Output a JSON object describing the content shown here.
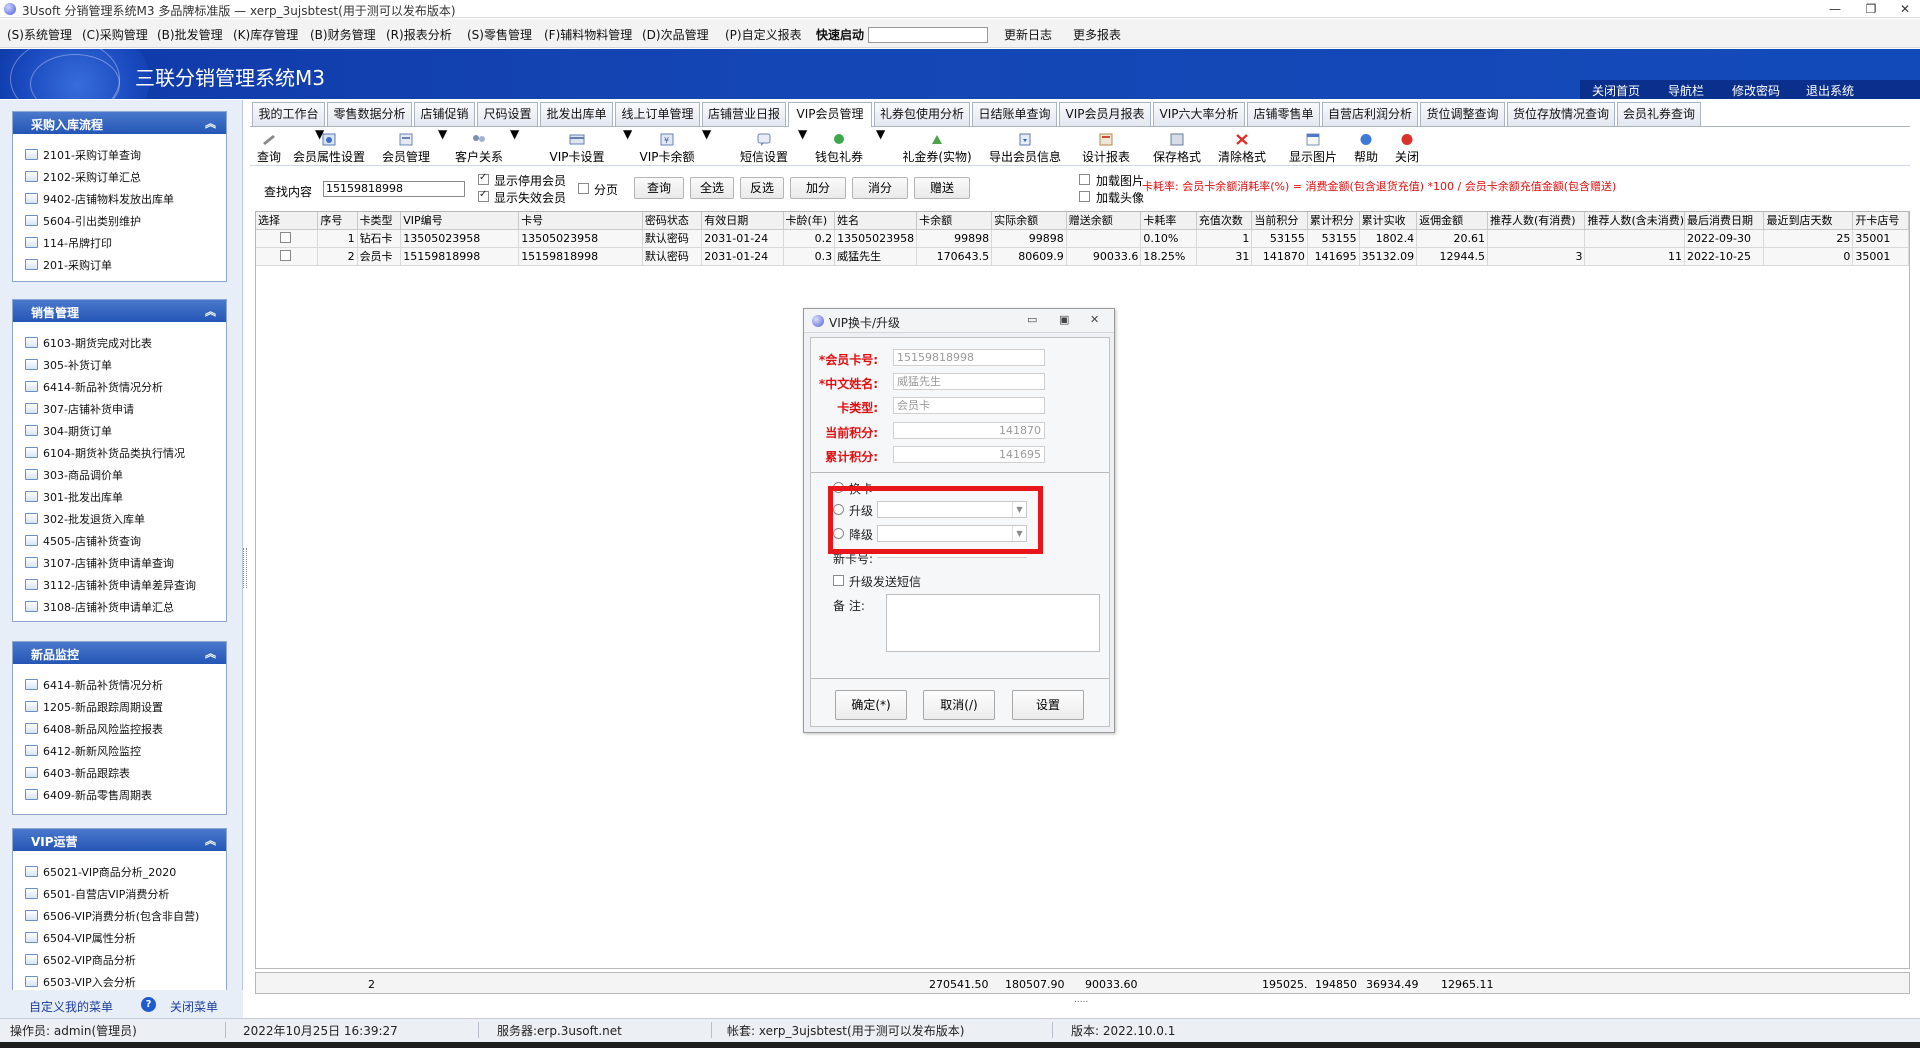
{
  "window": {
    "title": "3Usoft 分销管理系统M3 多品牌标准版 — xerp_3ujsbtest(用于测可以发布版本)",
    "controls": {
      "minimize": "—",
      "restore": "❐",
      "close": "✕"
    }
  },
  "menu": {
    "items": [
      "(S)系统管理",
      "(C)采购管理",
      "(B)批发管理",
      "(K)库存管理",
      "(B)财务管理",
      "(R)报表分析",
      "(S)零售管理",
      "(F)辅料物料管理",
      "(D)次品管理",
      "(P)自定义报表"
    ],
    "quick_launch_label": "快速启动",
    "quick_launch_value": "",
    "update_log": "更新日志",
    "more_reports": "更多报表"
  },
  "banner": {
    "title": "三联分销管理系统M3",
    "links": [
      "关闭首页",
      "导航栏",
      "修改密码",
      "退出系统"
    ]
  },
  "sidebar": {
    "panels": [
      {
        "title": "采购入库流程",
        "items": [
          "2101-采购订单查询",
          "2102-采购订单汇总",
          "9402-店铺物料发放出库单",
          "5604-引出类别维护",
          "114-吊牌打印",
          "201-采购订单"
        ]
      },
      {
        "title": "销售管理",
        "items": [
          "6103-期货完成对比表",
          "305-补货订单",
          "6414-新品补货情况分析",
          "307-店铺补货申请",
          "304-期货订单",
          "6104-期货补货品类执行情况",
          "303-商品调价单",
          "301-批发出库单",
          "302-批发退货入库单",
          "4505-店铺补货查询",
          "3107-店铺补货申请单查询",
          "3112-店铺补货申请单差异查询",
          "3108-店铺补货申请单汇总"
        ]
      },
      {
        "title": "新品监控",
        "items": [
          "6414-新品补货情况分析",
          "1205-新品跟踪周期设置",
          "6408-新品风险监控报表",
          "6412-新新风险监控",
          "6403-新品跟踪表",
          "6409-新品零售周期表"
        ]
      },
      {
        "title": "VIP运营",
        "items": [
          "65021-VIP商品分析_2020",
          "6501-自营店VIP消费分析",
          "6506-VIP消费分析(包含非自营)",
          "6504-VIP属性分析",
          "6502-VIP商品分析",
          "6503-VIP入会分析"
        ]
      }
    ],
    "chevron": "︽",
    "bottom": {
      "custom_menu": "自定义我的菜单",
      "help": "?",
      "close_menu": "关闭菜单"
    }
  },
  "tabs": [
    "我的工作台",
    "零售数据分析",
    "店铺促销",
    "尺码设置",
    "批发出库单",
    "线上订单管理",
    "店铺营业日报",
    "VIP会员管理",
    "礼券包使用分析",
    "日结账单查询",
    "VIP会员月报表",
    "VIP六大率分析",
    "店铺零售单",
    "自营店利润分析",
    "货位调整查询",
    "货位存放情况查询",
    "会员礼券查询"
  ],
  "active_tab": 7,
  "toolbar": {
    "items": [
      "查询",
      "会员属性设置",
      "会员管理",
      "客户关系",
      "VIP卡设置",
      "VIP卡余额",
      "短信设置",
      "钱包礼券",
      "礼金券(实物)",
      "导出会员信息",
      "设计报表",
      "保存格式",
      "清除格式",
      "显示图片",
      "帮助",
      "关闭"
    ],
    "dropdown_arrow": "▼"
  },
  "search": {
    "label": "查找内容",
    "value": "15159818998",
    "opts": [
      "显示停用会员",
      "显示失效会员",
      "分页",
      "加载图片",
      "加载头像"
    ],
    "buttons": [
      "查询",
      "全选",
      "反选",
      "加分",
      "消分",
      "赠送"
    ],
    "formula": "卡耗率: 会员卡余额消耗率(%) = 消费金额(包含退货充值) *100 / 会员卡余额充值金额(包含赠送)"
  },
  "grid": {
    "columns": [
      "选择",
      "序号",
      "卡类型",
      "VIP编号",
      "卡号",
      "密码状态",
      "有效日期",
      "卡龄(年)",
      "姓名",
      "卡余额",
      "实际余额",
      "赠送余额",
      "卡耗率",
      "充值次数",
      "当前积分",
      "累计积分",
      "累计实收",
      "返佣金额",
      "推荐人数(有消费)",
      "推荐人数(含未消费)",
      "最后消费日期",
      "最近到店天数",
      "开卡店号"
    ],
    "rows": [
      [
        "",
        "1",
        "钻石卡",
        "13505023958",
        "13505023958",
        "默认密码",
        "2031-01-24",
        "0.2",
        "13505023958",
        "99898",
        "99898",
        "",
        "0.10%",
        "1",
        "53155",
        "53155",
        "1802.4",
        "20.61",
        "",
        "",
        "2022-09-30",
        "25",
        "35001"
      ],
      [
        "",
        "2",
        "会员卡",
        "15159818998",
        "15159818998",
        "默认密码",
        "2031-01-24",
        "0.3",
        "威猛先生",
        "170643.5",
        "80609.9",
        "90033.6",
        "18.25%",
        "31",
        "141870",
        "141695",
        "35132.09",
        "12944.5",
        "3",
        "11",
        "2022-10-25",
        "0",
        "35001"
      ]
    ],
    "footer": {
      "count": "2",
      "card_balance": "270541.50",
      "actual_balance": "180507.90",
      "gift_balance": "90033.60",
      "current_points": "195025.",
      "total_points": "194850",
      "total_received": "36934.49",
      "rebate": "12965.11"
    },
    "resize_grip": "....."
  },
  "dialog": {
    "title": "VIP换卡/升级",
    "controls": {
      "min": "▭",
      "max": "▣",
      "close": "✕"
    },
    "card_no_label": "*会员卡号:",
    "card_no": "15159818998",
    "name_label": "*中文姓名:",
    "name": "威猛先生",
    "card_type_label": "卡类型:",
    "card_type": "会员卡",
    "current_points_label": "当前积分:",
    "current_points": "141870",
    "total_points_label": "累计积分:",
    "total_points": "141695",
    "option_swap": "换卡",
    "option_upgrade": "升级",
    "option_downgrade": "降级",
    "new_card_label": "新卡号:",
    "sms_label": "升级发送短信",
    "remark_label": "备  注:",
    "ok": "确定(*)",
    "cancel": "取消(/)",
    "settings": "设置",
    "combo_arrow": "▼"
  },
  "status": {
    "operator": "操作员: admin(管理员)",
    "datetime": "2022年10月25日 16:39:27",
    "server": "服务器:erp.3usoft.net",
    "account": "帐套: xerp_3ujsbtest(用于测可以发布版本)",
    "version": "版本: 2022.10.0.1"
  },
  "colors": {
    "banner": "#1546b5",
    "panel_header": "#2f62bf",
    "highlight": "#e8151a",
    "required": "#e01010"
  }
}
